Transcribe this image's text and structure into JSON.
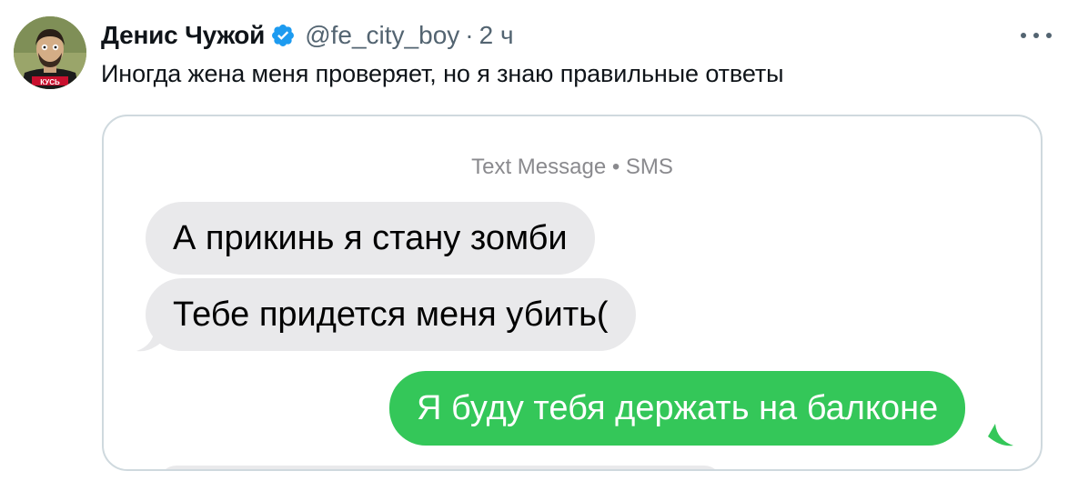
{
  "tweet": {
    "author_name": "Денис Чужой",
    "handle": "@fe_city_boy",
    "separator": "·",
    "time": "2 ч",
    "text": "Иногда жена меня проверяет, но я знаю правильные ответы",
    "avatar_shirt_text": "КУСЬ"
  },
  "media": {
    "service_label": "Text Message • SMS",
    "messages": [
      {
        "direction": "incoming",
        "text": "А прикинь я стану зомби"
      },
      {
        "direction": "incoming",
        "text": "Тебе придется меня убить("
      },
      {
        "direction": "outgoing",
        "text": "Я буду тебя держать на балконе"
      }
    ]
  },
  "colors": {
    "verified_badge": "#1d9bf0",
    "incoming_bubble": "#e9e9eb",
    "outgoing_bubble": "#34c759",
    "secondary_text": "#536471"
  },
  "icons": {
    "verified": "verified-badge-icon",
    "more": "more-horizontal-icon"
  }
}
